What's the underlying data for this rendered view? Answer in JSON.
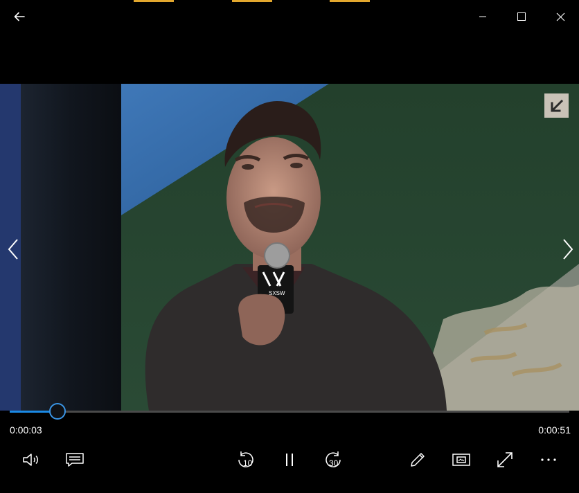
{
  "window": {
    "back_icon": "back-arrow-icon",
    "minimize_icon": "minimize-icon",
    "maximize_icon": "maximize-icon",
    "close_icon": "close-icon"
  },
  "video": {
    "pip_badge_icon": "arrow-down-left-icon",
    "prev_icon": "chevron-left-icon",
    "next_icon": "chevron-right-icon"
  },
  "playback": {
    "current_time": "0:00:03",
    "total_time": "0:00:51",
    "progress_fraction": 0.086
  },
  "controls": {
    "volume_icon": "volume-icon",
    "captions_icon": "captions-icon",
    "skip_back_label": "10",
    "play_pause_icon": "pause-icon",
    "skip_forward_label": "30",
    "edit_icon": "pencil-icon",
    "mini_view_icon": "mini-view-icon",
    "fullscreen_icon": "fullscreen-icon",
    "more_icon": "more-icon"
  },
  "colors": {
    "accent": "#1a8ae6",
    "background": "#000000"
  }
}
